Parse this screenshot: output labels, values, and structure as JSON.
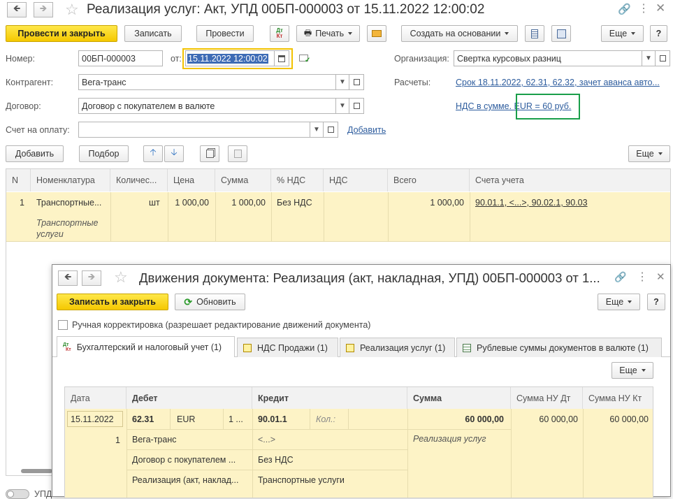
{
  "main": {
    "title": "Реализация услуг: Акт, УПД 00БП-000003 от 15.11.2022 12:00:02",
    "toolbar": {
      "post_close": "Провести и закрыть",
      "save": "Записать",
      "post": "Провести",
      "dtkt_top": "Дт",
      "dtkt_bottom": "Кт",
      "print": "Печать",
      "create_based": "Создать на основании",
      "more": "Еще",
      "help": "?"
    },
    "form": {
      "number_label": "Номер:",
      "number_value": "00БП-000003",
      "from_label": "от:",
      "date_value": "15.11.2022 12:00:02",
      "org_label": "Организация:",
      "org_value": "Свертка курсовых разниц",
      "contractor_label": "Контрагент:",
      "contractor_value": "Вега-транс",
      "settlements_label": "Расчеты:",
      "settlements_link": "Срок 18.11.2022, 62.31, 62.32, зачет аванса авто...",
      "contract_label": "Договор:",
      "contract_value": "Договор с покупателем в валюте",
      "vat_link": "НДС в сумме. EUR = 60 руб.",
      "invoice_label": "Счет на оплату:",
      "invoice_value": "",
      "add_link": "Добавить"
    },
    "table_toolbar": {
      "add": "Добавить",
      "pick": "Подбор",
      "more": "Еще"
    },
    "table": {
      "headers": [
        "N",
        "Номенклатура",
        "Количес...",
        "Цена",
        "Сумма",
        "% НДС",
        "НДС",
        "Всего",
        "Счета учета"
      ],
      "row": {
        "n": "1",
        "item": "Транспортные...",
        "item_desc": "Транспортные услуги",
        "unit": "шт",
        "price": "1 000,00",
        "sum": "1 000,00",
        "vat_rate": "Без НДС",
        "vat": "",
        "total": "1 000,00",
        "accounts": "90.01.1, <...>, 90.02.1, 90.03"
      }
    },
    "bottom_partial": "УПД"
  },
  "dialog": {
    "title": "Движения документа: Реализация (акт, накладная, УПД) 00БП-000003 от 1...",
    "save_close": "Записать и закрыть",
    "refresh": "Обновить",
    "more": "Еще",
    "help": "?",
    "manual_label": "Ручная корректировка (разрешает редактирование движений документа)",
    "tabs": [
      "Бухгалтерский и налоговый учет (1)",
      "НДС Продажи (1)",
      "Реализация услуг (1)",
      "Рублевые суммы документов в валюте (1)"
    ],
    "table_more": "Еще",
    "grid": {
      "headers": [
        "Дата",
        "Дебет",
        "Кредит",
        "Сумма",
        "Сумма НУ Дт",
        "Сумма НУ Кт"
      ],
      "date": "15.11.2022",
      "debit_account": "62.31",
      "debit_currency": "EUR",
      "debit_extra": "1 ...",
      "credit_account": "90.01.1",
      "credit_qty_label": "Кол.:",
      "amount": "60 000,00",
      "nu_dt": "60 000,00",
      "nu_kt": "60 000,00",
      "line_no": "1",
      "debit_sub1": "Вега-транс",
      "debit_sub2": "Договор с покупателем ...",
      "debit_sub3": "Реализация (акт, наклад...",
      "credit_sub1": "<...>",
      "credit_sub2": "Без НДС",
      "credit_sub3": "Транспортные услуги",
      "content": "Реализация услуг"
    }
  },
  "colors": {
    "accent_yellow": "#f5c800",
    "row_highlight": "#fdf3c6",
    "link_blue": "#2e5d9e",
    "highlight_green": "#1a9e4a"
  }
}
